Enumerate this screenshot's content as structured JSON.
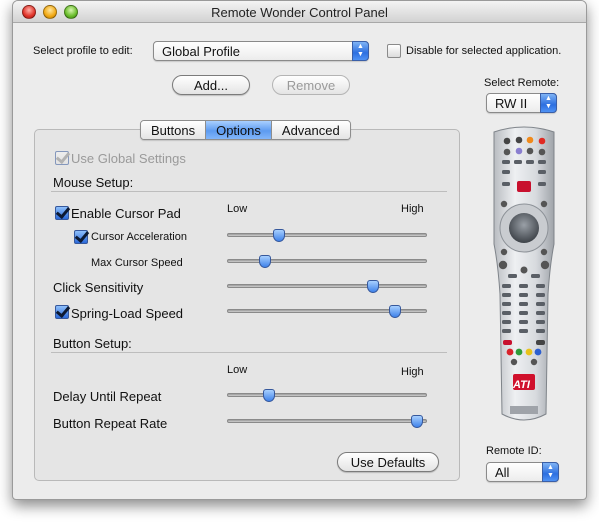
{
  "window": {
    "title": "Remote Wonder Control Panel"
  },
  "profile": {
    "label": "Select profile to edit:",
    "value": "Global Profile",
    "disable_label": "Disable for selected application.",
    "disable_checked": false
  },
  "buttons": {
    "add": "Add...",
    "remove": "Remove",
    "use_defaults": "Use Defaults"
  },
  "remote": {
    "select_label": "Select Remote:",
    "select_value": "RW II",
    "id_label": "Remote ID:",
    "id_value": "All",
    "logo": "ATI"
  },
  "tabs": [
    {
      "label": "Buttons",
      "active": false
    },
    {
      "label": "Options",
      "active": true
    },
    {
      "label": "Advanced",
      "active": false
    }
  ],
  "options": {
    "use_global": {
      "label": "Use Global Settings",
      "checked": true,
      "enabled": false
    },
    "mouse_setup": "Mouse Setup:",
    "button_setup": "Button Setup:",
    "scale_low": "Low",
    "scale_high": "High",
    "enable_cursor_pad": {
      "label": "Enable Cursor Pad",
      "checked": true
    },
    "cursor_acceleration": {
      "label": "Cursor Acceleration",
      "checked": true,
      "level": 0.26
    },
    "max_cursor_speed": {
      "label": "Max Cursor Speed",
      "level": 0.19
    },
    "click_sensitivity": {
      "label": "Click Sensitivity",
      "level": 0.73
    },
    "spring_load_speed": {
      "label": "Spring-Load Speed",
      "checked": true,
      "level": 0.84
    },
    "delay_until_repeat": {
      "label": "Delay Until Repeat",
      "level": 0.21
    },
    "button_repeat_rate": {
      "label": "Button Repeat Rate",
      "level": 0.95
    }
  }
}
